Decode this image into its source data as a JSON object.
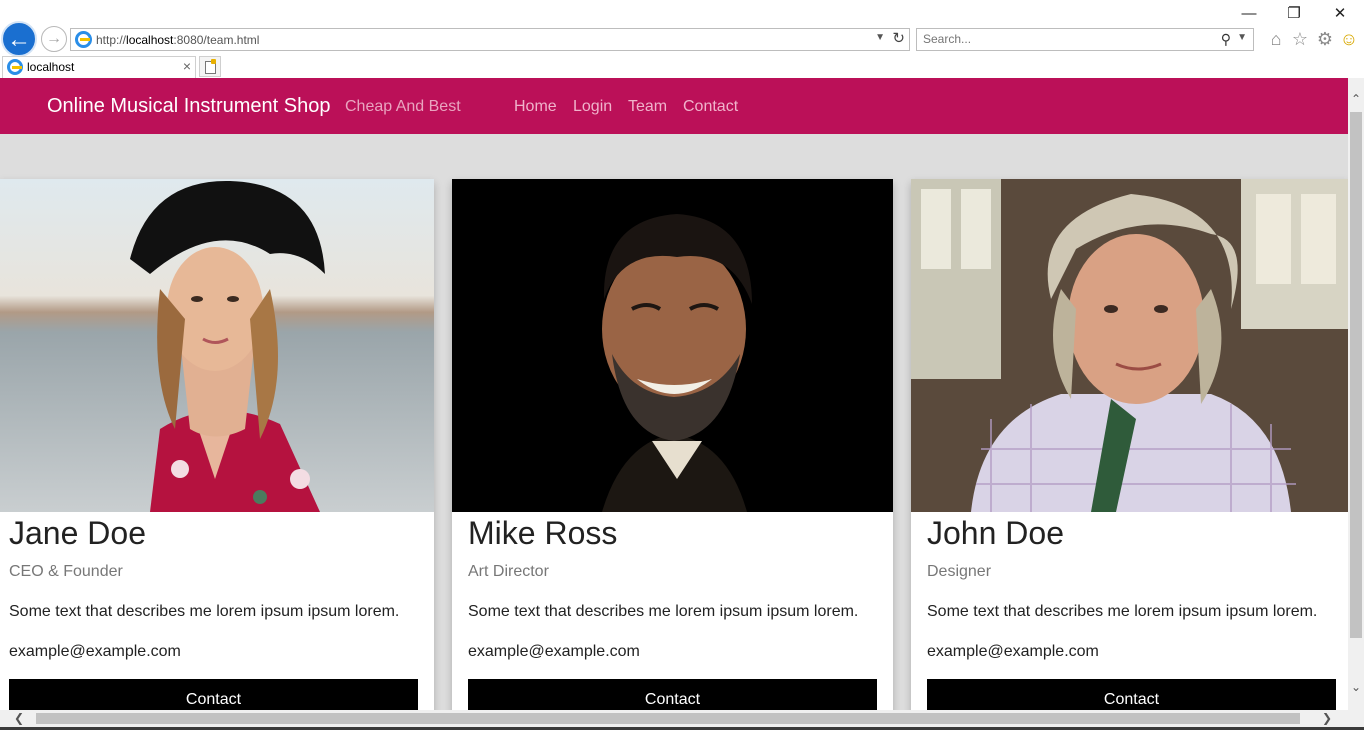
{
  "browser": {
    "url_prefix": "http://",
    "url_host": "localhost",
    "url_rest": ":8080/team.html",
    "search_placeholder": "Search...",
    "tab_title": "localhost",
    "window_controls": {
      "minimize": "—",
      "restore": "❐",
      "close": "✕"
    }
  },
  "navbar": {
    "brand": "Online Musical Instrument Shop",
    "tagline": "Cheap And Best",
    "links": [
      "Home",
      "Login",
      "Team",
      "Contact"
    ]
  },
  "team": [
    {
      "name": "Jane Doe",
      "role": "CEO & Founder",
      "description": "Some text that describes me lorem ipsum ipsum lorem.",
      "email": "example@example.com",
      "button": "Contact"
    },
    {
      "name": "Mike Ross",
      "role": "Art Director",
      "description": "Some text that describes me lorem ipsum ipsum lorem.",
      "email": "example@example.com",
      "button": "Contact"
    },
    {
      "name": "John Doe",
      "role": "Designer",
      "description": "Some text that describes me lorem ipsum ipsum lorem.",
      "email": "example@example.com",
      "button": "Contact"
    }
  ],
  "colors": {
    "navbar_bg": "#bb1058",
    "page_bg": "#dddddd",
    "button_bg": "#000000"
  }
}
